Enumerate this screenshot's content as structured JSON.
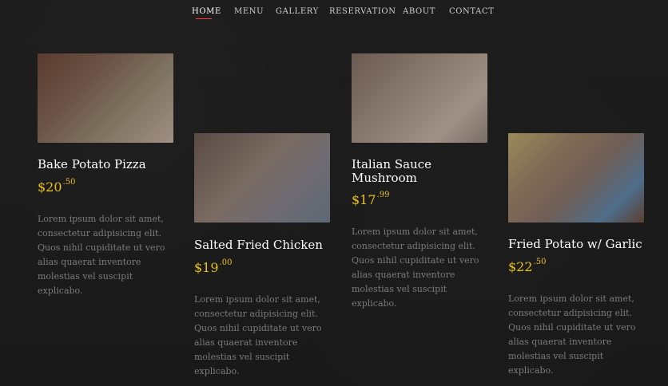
{
  "nav": {
    "items": [
      {
        "label": "HOME"
      },
      {
        "label": "MENU"
      },
      {
        "label": "GALLERY"
      },
      {
        "label": "RESERVATION"
      },
      {
        "label": "ABOUT"
      },
      {
        "label": "CONTACT"
      }
    ]
  },
  "menu": {
    "items": [
      {
        "title": "Bake Potato Pizza",
        "price_main": "$20",
        "price_cents": ".50",
        "description": "Lorem ipsum dolor sit amet, consectetur adipisicing elit. Quos nihil cupiditate ut vero alias quaerat inventore molestias vel suscipit explicabo."
      },
      {
        "title": "Salted Fried Chicken",
        "price_main": "$19",
        "price_cents": ".00",
        "description": "Lorem ipsum dolor sit amet, consectetur adipisicing elit. Quos nihil cupiditate ut vero alias quaerat inventore molestias vel suscipit explicabo."
      },
      {
        "title": "Italian Sauce Mushroom",
        "price_main": "$17",
        "price_cents": ".99",
        "description": "Lorem ipsum dolor sit amet, consectetur adipisicing elit. Quos nihil cupiditate ut vero alias quaerat inventore molestias vel suscipit explicabo."
      },
      {
        "title": "Fried Potato w/ Garlic",
        "price_main": "$22",
        "price_cents": ".50",
        "description": "Lorem ipsum dolor sit amet, consectetur adipisicing elit. Quos nihil cupiditate ut vero alias quaerat inventore molestias vel suscipit explicabo."
      }
    ]
  },
  "colors": {
    "background": "#1b1b1b",
    "accent_price": "#e8c21c",
    "nav_active_underline": "#ff3b3b"
  }
}
